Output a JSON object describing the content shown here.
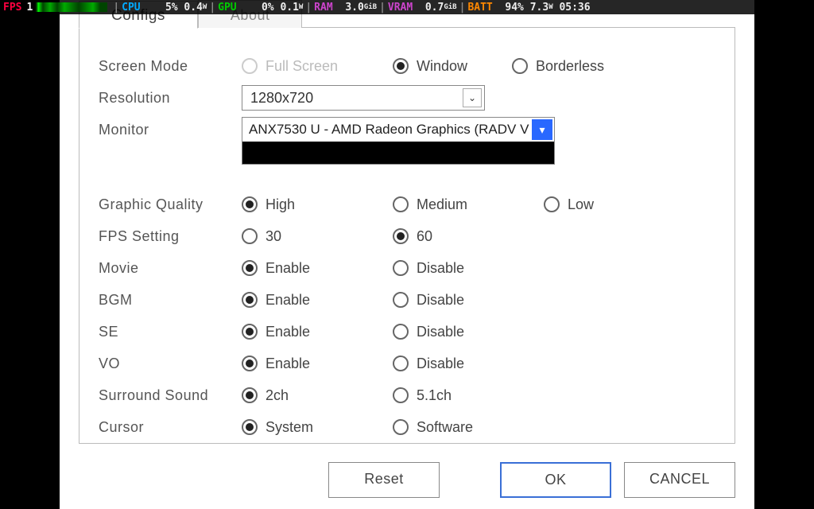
{
  "overlay": {
    "fps_label": "FPS",
    "fps_val": "1",
    "cpu_label": "CPU",
    "cpu_pct": "5%",
    "cpu_w": "0.4",
    "gpu_label": "GPU",
    "gpu_pct": "0%",
    "gpu_w": "0.1",
    "ram_label": "RAM",
    "ram_val": "3.0",
    "ram_unit": "GiB",
    "vram_label": "VRAM",
    "vram_val": "0.7",
    "vram_unit": "GiB",
    "batt_label": "BATT",
    "batt_pct": "94%",
    "batt_w": "7.3",
    "time": "05:36"
  },
  "tabs": {
    "configs": "Configs",
    "about": "About"
  },
  "labels": {
    "screen_mode": "Screen Mode",
    "resolution": "Resolution",
    "monitor": "Monitor",
    "graphic_quality": "Graphic Quality",
    "fps_setting": "FPS Setting",
    "movie": "Movie",
    "bgm": "BGM",
    "se": "SE",
    "vo": "VO",
    "surround": "Surround Sound",
    "cursor": "Cursor"
  },
  "options": {
    "full_screen": "Full Screen",
    "window": "Window",
    "borderless": "Borderless",
    "resolution_value": "1280x720",
    "monitor_value": "ANX7530 U - AMD Radeon Graphics (RADV V",
    "high": "High",
    "medium": "Medium",
    "low": "Low",
    "fps30": "30",
    "fps60": "60",
    "enable": "Enable",
    "disable": "Disable",
    "ch2": "2ch",
    "ch51": "5.1ch",
    "system": "System",
    "software": "Software"
  },
  "buttons": {
    "reset": "Reset",
    "ok": "OK",
    "cancel": "CANCEL"
  }
}
